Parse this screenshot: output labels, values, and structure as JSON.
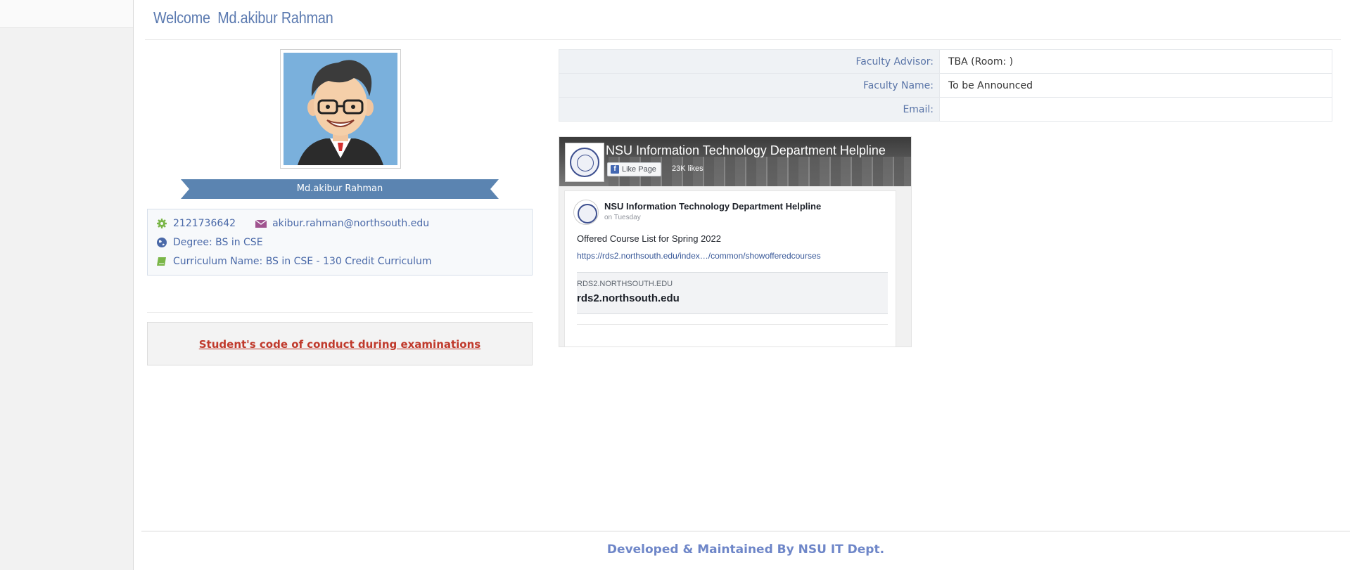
{
  "header": {
    "welcome_label": "Welcome",
    "user_name": "Md.akibur Rahman"
  },
  "profile": {
    "name_banner": "Md.akibur Rahman",
    "student_id": "2121736642",
    "email": "akibur.rahman@northsouth.edu",
    "degree": "Degree: BS in CSE",
    "curriculum": "Curriculum Name: BS in CSE - 130 Credit Curriculum",
    "icons": [
      "gear-icon",
      "envelope-icon",
      "globe-icon",
      "book-icon"
    ],
    "icon_colors": {
      "gear": "#7ab648",
      "envelope": "#a0548f",
      "globe": "#4a69a8",
      "book": "#7ab648"
    }
  },
  "conduct": {
    "link_text": "Student's code of conduct during examinations"
  },
  "faculty": {
    "rows": [
      {
        "label": "Faculty Advisor:",
        "value": "TBA (Room: )"
      },
      {
        "label": "Faculty Name:",
        "value": "To be Announced"
      },
      {
        "label": "Email:",
        "value": ""
      }
    ]
  },
  "facebook": {
    "page_title": "NSU Information Technology Department Helpline",
    "like_button": "Like Page",
    "likes": "23K likes",
    "post": {
      "author": "NSU Information Technology Department Helpline",
      "time": "on Tuesday",
      "text": "Offered Course List for Spring 2022",
      "link": "https://rds2.northsouth.edu/index…/common/showofferedcourses",
      "card_domain": "RDS2.NORTHSOUTH.EDU",
      "card_title": "rds2.northsouth.edu"
    }
  },
  "footer": {
    "text": "Developed & Maintained By NSU IT Dept."
  },
  "colors": {
    "accent": "#5b7ab0",
    "ribbon": "#5b84b1",
    "conduct_link": "#c0392b",
    "footer": "#6e86c8"
  }
}
